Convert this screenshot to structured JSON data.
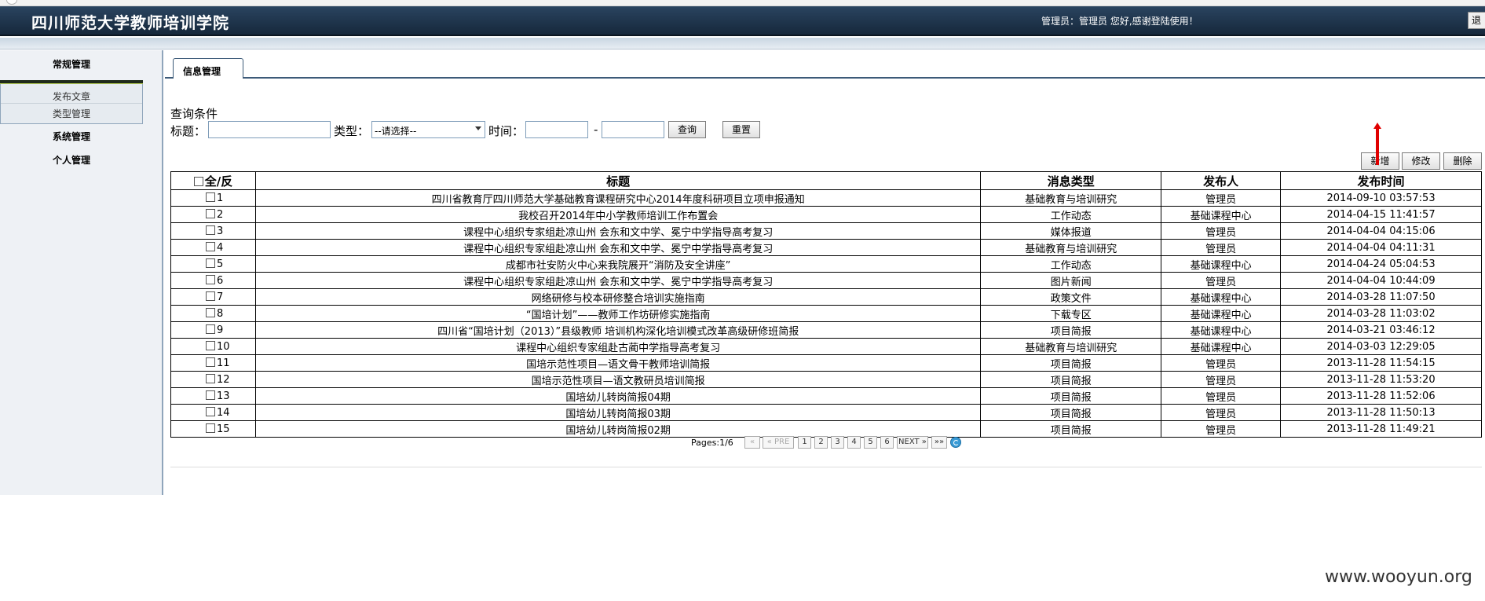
{
  "header": {
    "title": "四川师范大学教师培训学院",
    "welcome": "管理员：管理员 您好,感谢登陆使用！",
    "logout_label": "退"
  },
  "sidebar": {
    "groups": [
      {
        "label": "常规管理",
        "items": [
          {
            "label": "发布文章"
          },
          {
            "label": "类型管理"
          }
        ]
      },
      {
        "label": "系统管理"
      },
      {
        "label": "个人管理"
      }
    ]
  },
  "main": {
    "tab_label": "信息管理",
    "query": {
      "heading": "查询条件",
      "title_label": "标题：",
      "title_value": "",
      "type_label": "类型：",
      "type_selected": "--请选择--",
      "time_label": "时间：",
      "time_start": "",
      "time_sep": "-",
      "time_end": "",
      "search_label": "查询",
      "reset_label": "重置"
    },
    "actions": {
      "add_label": "新增",
      "edit_label": "修改",
      "delete_label": "删除"
    },
    "table": {
      "headers": [
        "全/反",
        "标题",
        "消息类型",
        "发布人",
        "发布时间"
      ],
      "rows": [
        {
          "id": "1",
          "title": "四川省教育厅四川师范大学基础教育课程研究中心2014年度科研项目立项申报通知",
          "type": "基础教育与培训研究",
          "publisher": "管理员",
          "time": "2014-09-10 03:57:53"
        },
        {
          "id": "2",
          "title": "我校召开2014年中小学教师培训工作布置会",
          "type": "工作动态",
          "publisher": "基础课程中心",
          "time": "2014-04-15 11:41:57"
        },
        {
          "id": "3",
          "title": "课程中心组织专家组赴凉山州 会东和文中学、冕宁中学指导高考复习",
          "type": "媒体报道",
          "publisher": "管理员",
          "time": "2014-04-04 04:15:06"
        },
        {
          "id": "4",
          "title": "课程中心组织专家组赴凉山州 会东和文中学、冕宁中学指导高考复习",
          "type": "基础教育与培训研究",
          "publisher": "管理员",
          "time": "2014-04-04 04:11:31"
        },
        {
          "id": "5",
          "title": "成都市社安防火中心来我院展开“消防及安全讲座”",
          "type": "工作动态",
          "publisher": "基础课程中心",
          "time": "2014-04-24 05:04:53"
        },
        {
          "id": "6",
          "title": "课程中心组织专家组赴凉山州 会东和文中学、冕宁中学指导高考复习",
          "type": "图片新闻",
          "publisher": "管理员",
          "time": "2014-04-04 10:44:09"
        },
        {
          "id": "7",
          "title": "网络研修与校本研修整合培训实施指南",
          "type": "政策文件",
          "publisher": "基础课程中心",
          "time": "2014-03-28 11:07:50"
        },
        {
          "id": "8",
          "title": "“国培计划”——教师工作坊研修实施指南",
          "type": "下载专区",
          "publisher": "基础课程中心",
          "time": "2014-03-28 11:03:02"
        },
        {
          "id": "9",
          "title": "四川省“国培计划（2013）”县级教师 培训机构深化培训模式改革高级研修班简报",
          "type": "项目简报",
          "publisher": "基础课程中心",
          "time": "2014-03-21 03:46:12"
        },
        {
          "id": "10",
          "title": "课程中心组织专家组赴古蔺中学指导高考复习",
          "type": "基础教育与培训研究",
          "publisher": "基础课程中心",
          "time": "2014-03-03 12:29:05"
        },
        {
          "id": "11",
          "title": "国培示范性项目—语文骨干教师培训简报",
          "type": "项目简报",
          "publisher": "管理员",
          "time": "2013-11-28 11:54:15"
        },
        {
          "id": "12",
          "title": "国培示范性项目—语文教研员培训简报",
          "type": "项目简报",
          "publisher": "管理员",
          "time": "2013-11-28 11:53:20"
        },
        {
          "id": "13",
          "title": "国培幼儿转岗简报04期",
          "type": "项目简报",
          "publisher": "管理员",
          "time": "2013-11-28 11:52:06"
        },
        {
          "id": "14",
          "title": "国培幼儿转岗简报03期",
          "type": "项目简报",
          "publisher": "管理员",
          "time": "2013-11-28 11:50:13"
        },
        {
          "id": "15",
          "title": "国培幼儿转岗简报02期",
          "type": "项目简报",
          "publisher": "管理员",
          "time": "2013-11-28 11:49:21"
        }
      ]
    },
    "pager": {
      "label": "Pages:1/6",
      "first": "«",
      "prev": "« PRE",
      "pages": [
        "1",
        "2",
        "3",
        "4",
        "5",
        "6"
      ],
      "next": "NEXT »",
      "last": "»»"
    }
  },
  "watermark": "www.wooyun.org",
  "colors": {
    "header_bg": "#1f354d",
    "annotation_arrow": "#e00000"
  }
}
